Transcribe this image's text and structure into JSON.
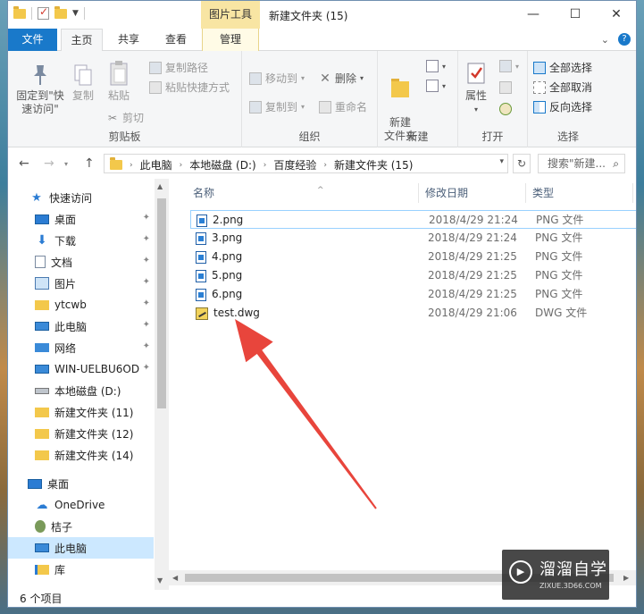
{
  "window": {
    "title": "新建文件夹 (15)",
    "tool_tab": "图片工具",
    "minimize": "—",
    "maximize": "☐",
    "close": "✕"
  },
  "ribbon_tabs": {
    "file": "文件",
    "home": "主页",
    "share": "共享",
    "view": "查看",
    "manage": "管理",
    "expand": "⌄",
    "help": "?"
  },
  "ribbon": {
    "clipboard": {
      "label": "剪贴板",
      "pin": "固定到\"快速访问\"",
      "copy": "复制",
      "paste": "粘贴",
      "copy_path": "复制路径",
      "paste_shortcut": "粘贴快捷方式",
      "cut": "剪切"
    },
    "organize": {
      "label": "组织",
      "move_to": "移动到",
      "copy_to": "复制到",
      "delete": "删除",
      "rename": "重命名"
    },
    "new": {
      "label": "新建",
      "new_folder": "新建\n文件夹"
    },
    "open": {
      "label": "打开",
      "properties": "属性"
    },
    "select": {
      "label": "选择",
      "select_all": "全部选择",
      "select_none": "全部取消",
      "invert": "反向选择"
    }
  },
  "nav": {
    "back": "←",
    "forward": "→",
    "up": "↑",
    "breadcrumb": [
      "此电脑",
      "本地磁盘 (D:)",
      "百度经验",
      "新建文件夹 (15)"
    ],
    "refresh": "↻",
    "search_placeholder": "搜索\"新建...",
    "search_icon": "⌕"
  },
  "sidebar": {
    "items": [
      {
        "label": "快速访问",
        "icon": "star-icon"
      },
      {
        "label": "桌面",
        "icon": "desktop-icon",
        "pinned": true
      },
      {
        "label": "下载",
        "icon": "download-icon",
        "pinned": true
      },
      {
        "label": "文档",
        "icon": "document-icon",
        "pinned": true
      },
      {
        "label": "图片",
        "icon": "picture-icon",
        "pinned": true
      },
      {
        "label": "ytcwb",
        "icon": "folder-icon",
        "pinned": true
      },
      {
        "label": "此电脑",
        "icon": "computer-icon",
        "pinned": true
      },
      {
        "label": "网络",
        "icon": "network-icon",
        "pinned": true
      },
      {
        "label": "WIN-UELBU6OD",
        "icon": "computer-icon",
        "pinned": true
      },
      {
        "label": "本地磁盘 (D:)",
        "icon": "drive-icon"
      },
      {
        "label": "新建文件夹 (11)",
        "icon": "folder-icon"
      },
      {
        "label": "新建文件夹 (12)",
        "icon": "folder-icon"
      },
      {
        "label": "新建文件夹 (14)",
        "icon": "folder-icon"
      },
      {
        "label": "桌面",
        "icon": "desktop-icon"
      },
      {
        "label": "OneDrive",
        "icon": "cloud-icon"
      },
      {
        "label": "桔子",
        "icon": "user-icon"
      },
      {
        "label": "此电脑",
        "icon": "computer-icon"
      },
      {
        "label": "库",
        "icon": "library-icon"
      }
    ],
    "pin_glyph": "📌"
  },
  "columns": {
    "name": "名称",
    "date": "修改日期",
    "type": "类型"
  },
  "files": [
    {
      "name": "2.png",
      "date": "2018/4/29 21:24",
      "type": "PNG 文件"
    },
    {
      "name": "3.png",
      "date": "2018/4/29 21:24",
      "type": "PNG 文件"
    },
    {
      "name": "4.png",
      "date": "2018/4/29 21:25",
      "type": "PNG 文件"
    },
    {
      "name": "5.png",
      "date": "2018/4/29 21:25",
      "type": "PNG 文件"
    },
    {
      "name": "6.png",
      "date": "2018/4/29 21:25",
      "type": "PNG 文件"
    },
    {
      "name": "test.dwg",
      "date": "2018/4/29 21:06",
      "type": "DWG 文件"
    }
  ],
  "status": {
    "count": "6 个项目"
  },
  "watermark": {
    "text": "溜溜自学",
    "url": "ZIXUE.3D66.COM"
  },
  "colors": {
    "accent": "#1979ca",
    "tool_tab": "#f8e5a3",
    "selection": "#cce8ff",
    "arrow": "#e8453c"
  }
}
